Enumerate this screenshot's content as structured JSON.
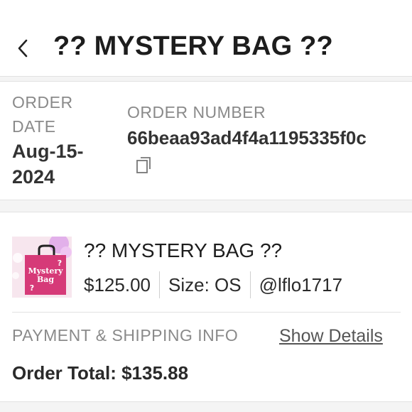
{
  "header": {
    "title": "?? MYSTERY BAG ??",
    "back_icon": "chevron-left-icon"
  },
  "order": {
    "date_label": "ORDER DATE",
    "date_value": "Aug-15-2024",
    "number_label": "ORDER NUMBER",
    "number_value": "66beaa93ad4f4a1195335f0c",
    "copy_icon": "copy-icon"
  },
  "item": {
    "name": "?? MYSTERY BAG ??",
    "price": "$125.00",
    "size": "Size: OS",
    "seller": "@lflo1717",
    "thumbnail": {
      "bag_text_line1": "Mystery",
      "bag_text_line2": "Bag",
      "question_mark": "?",
      "bag_color": "#d63a78"
    }
  },
  "payment": {
    "label": "PAYMENT & SHIPPING INFO",
    "show_details": "Show Details",
    "order_total": "Order Total: $135.88"
  }
}
